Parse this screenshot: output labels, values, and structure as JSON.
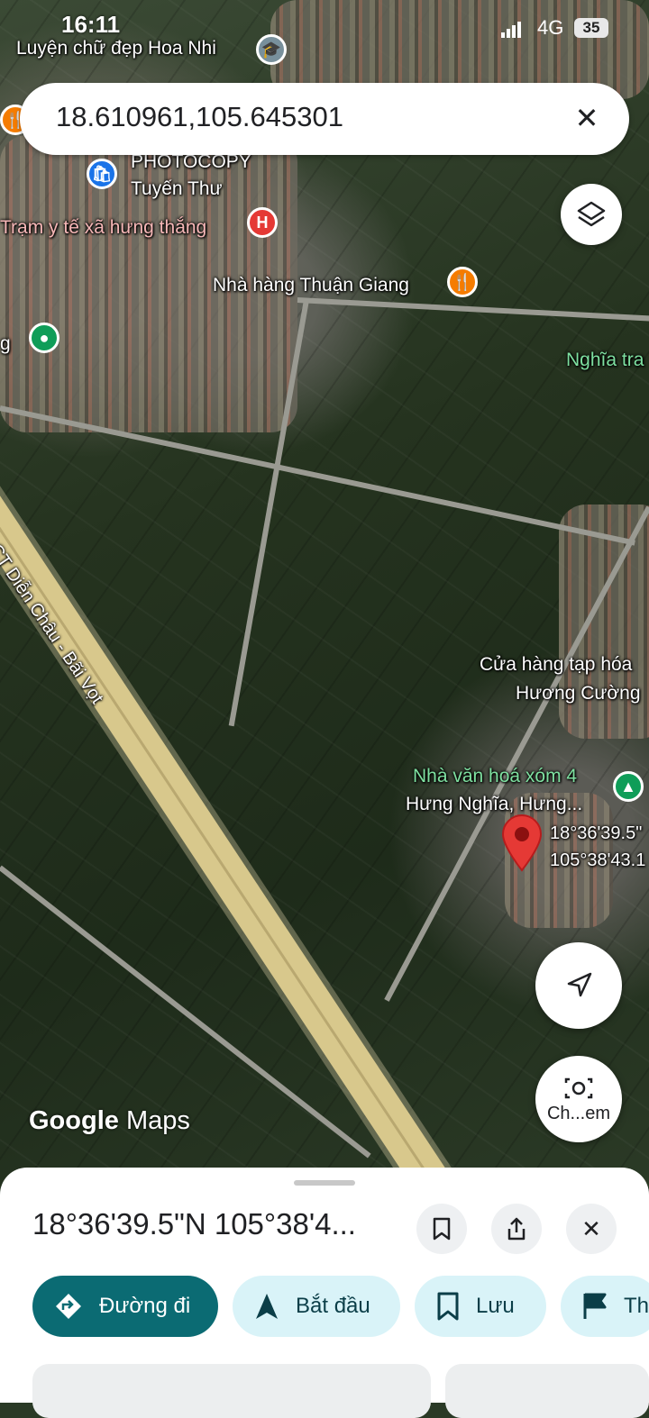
{
  "status_bar": {
    "time": "16:11",
    "network": "4G",
    "battery": "35"
  },
  "search": {
    "query": "18.610961,105.645301",
    "clear_icon": "close-icon"
  },
  "map_labels": {
    "label_1": "Luyện chữ đẹp Hoa Nhi",
    "label_2": "PHOTOCOPY",
    "label_3": "Tuyến Thư",
    "label_4": "Trạm y tế xã hưng thắng",
    "label_5": "Nhà hàng Thuận Giang",
    "label_6": "Nghĩa tra",
    "label_7": "g",
    "label_8": "CT Diễn Châu - Bãi Vọt",
    "label_9": "Cửa hàng tạp hóa",
    "label_10": "Hương Cường",
    "label_11": "Nhà văn hoá xóm 4",
    "label_12": "Hưng Nghĩa, Hưng...",
    "label_13": "18°36'39.5\"",
    "label_14": "105°38'43.1"
  },
  "controls": {
    "camera_label": "Ch...em",
    "layers_icon": "layers-icon",
    "location_icon": "navigation-arrow-icon"
  },
  "watermark": {
    "google": "Google",
    "maps": "Maps"
  },
  "sheet": {
    "title": "18°36'39.5\"N 105°38'4...",
    "chips": [
      {
        "label": "Đường đi",
        "icon": "directions-icon"
      },
      {
        "label": "Bắt đầu",
        "icon": "navigation-icon"
      },
      {
        "label": "Lưu",
        "icon": "bookmark-icon"
      },
      {
        "label": "Th",
        "icon": "flag-icon"
      }
    ]
  },
  "colors": {
    "pin_red": "#e53935",
    "directions_chip": "#0b6b73",
    "chip_bg": "#d9f3f8"
  }
}
